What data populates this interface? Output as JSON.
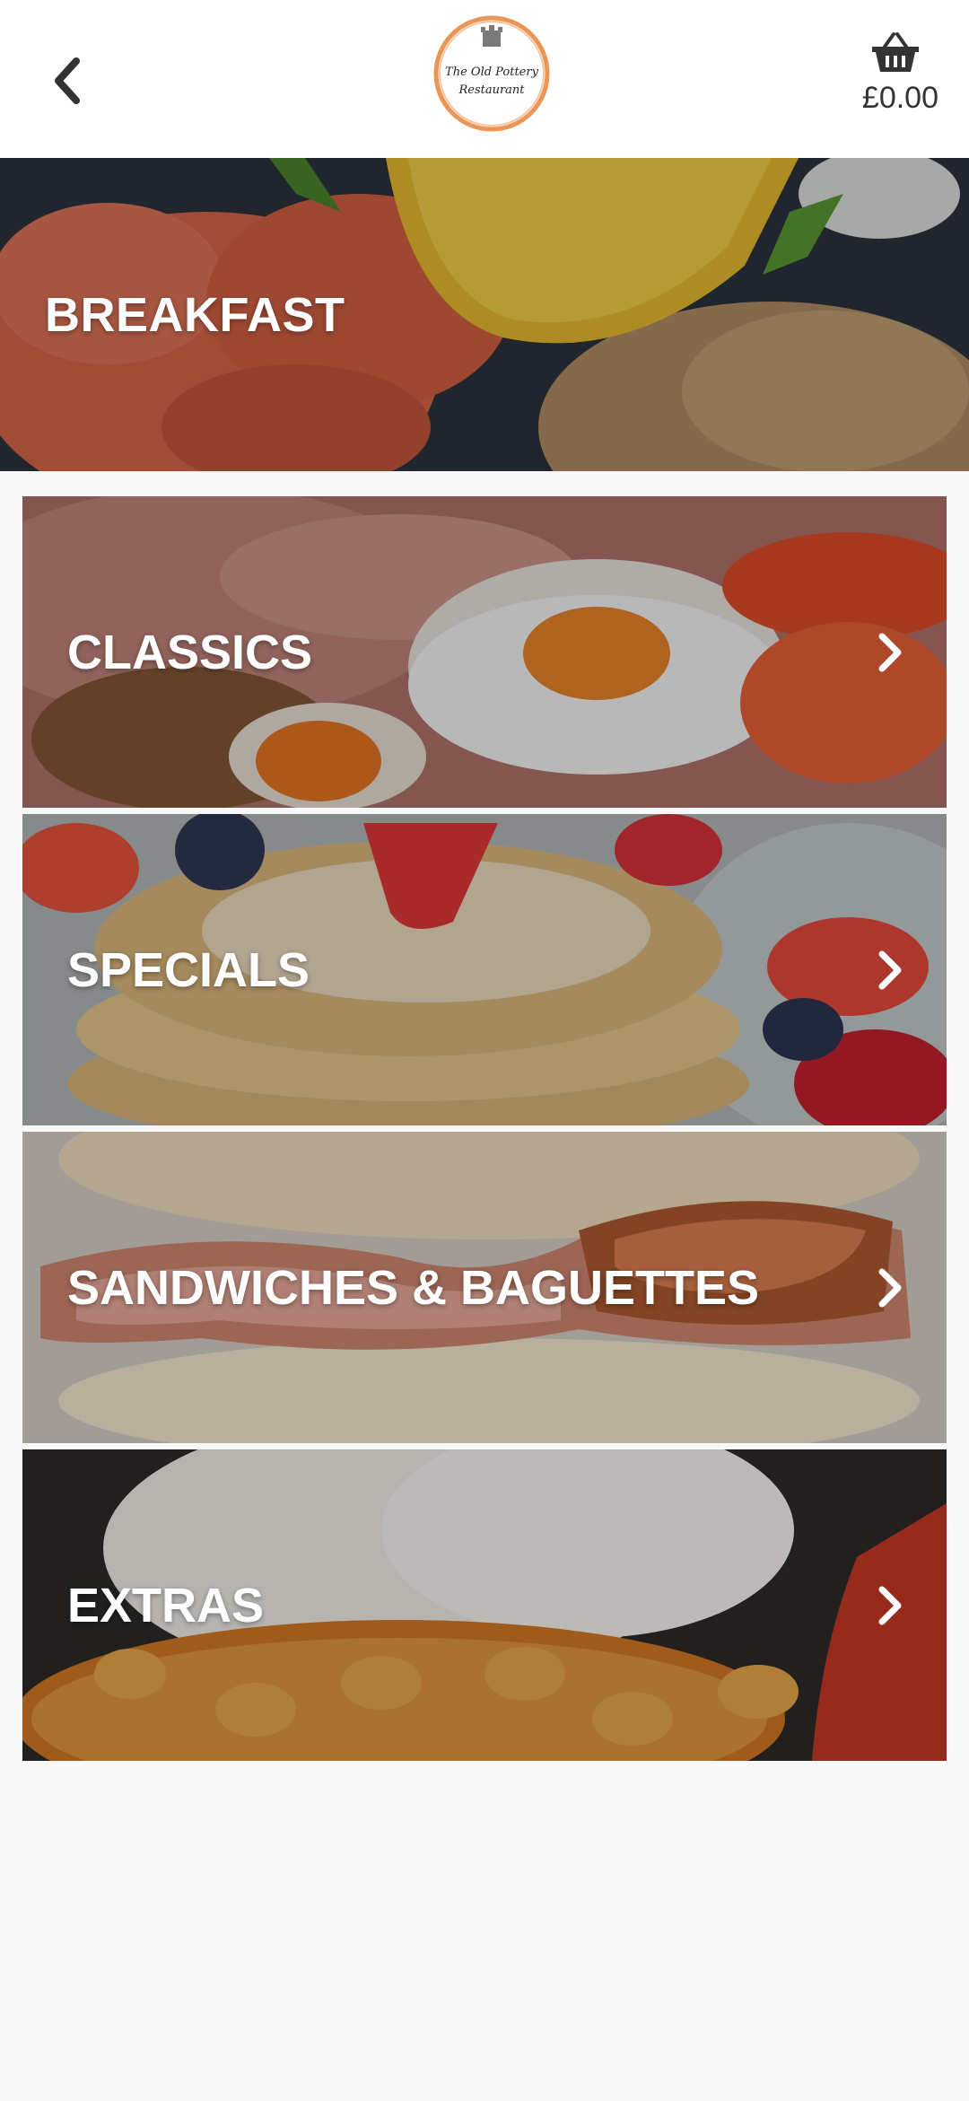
{
  "header": {
    "back_icon": "chevron-left-icon",
    "logo_line1": "The Old Pottery",
    "logo_line2": "Restaurant",
    "cart_icon": "basket-icon",
    "cart_total": "£0.00"
  },
  "hero": {
    "title": "BREAKFAST"
  },
  "categories": [
    {
      "label": "CLASSICS"
    },
    {
      "label": "SPECIALS"
    },
    {
      "label": "SANDWICHES & BAGUETTES"
    },
    {
      "label": "EXTRAS"
    }
  ],
  "colors": {
    "header_bg": "#ffffff",
    "page_bg": "#f8f8f8",
    "logo_accent": "#e8833a",
    "text_on_image": "#ffffff"
  }
}
